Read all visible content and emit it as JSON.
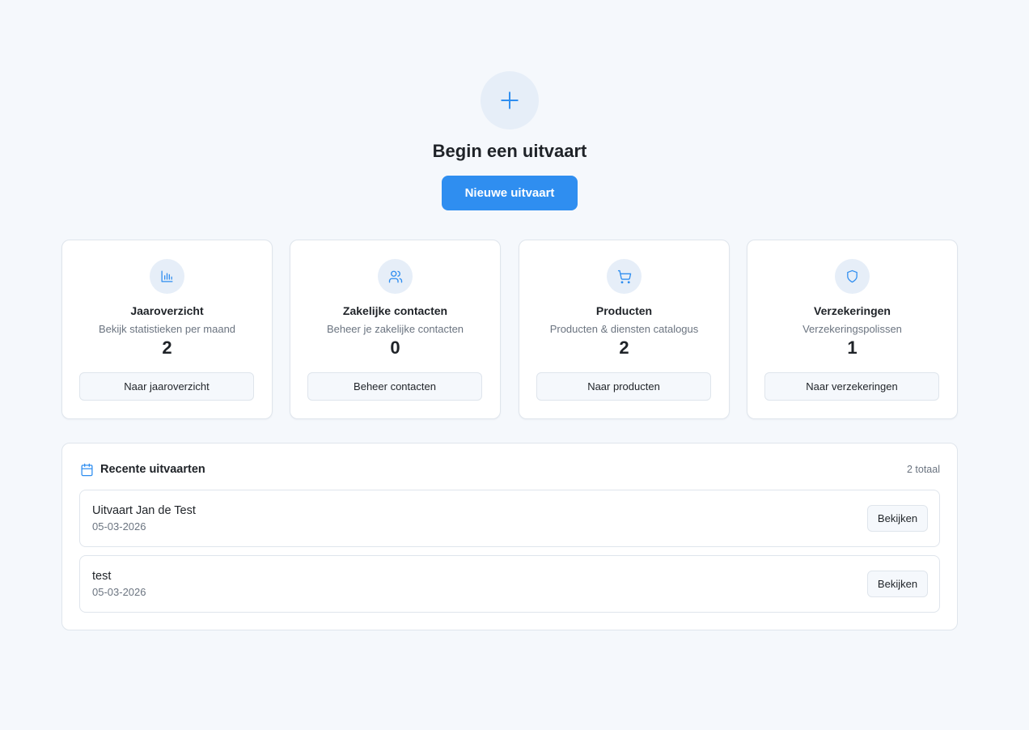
{
  "hero": {
    "icon": "plus-icon",
    "title": "Begin een uitvaart",
    "button_label": "Nieuwe uitvaart"
  },
  "colors": {
    "accent": "#2f8ef0",
    "background": "#f5f8fc",
    "icon_bg": "#e6eef8"
  },
  "cards": [
    {
      "icon": "bar-chart-icon",
      "title": "Jaaroverzicht",
      "subtitle": "Bekijk statistieken per maand",
      "count": "2",
      "button_label": "Naar jaaroverzicht"
    },
    {
      "icon": "users-icon",
      "title": "Zakelijke contacten",
      "subtitle": "Beheer je zakelijke contacten",
      "count": "0",
      "button_label": "Beheer contacten"
    },
    {
      "icon": "shopping-cart-icon",
      "title": "Producten",
      "subtitle": "Producten & diensten catalogus",
      "count": "2",
      "button_label": "Naar producten"
    },
    {
      "icon": "shield-icon",
      "title": "Verzekeringen",
      "subtitle": "Verzekeringspolissen",
      "count": "1",
      "button_label": "Naar verzekeringen"
    }
  ],
  "recent": {
    "icon": "calendar-icon",
    "title": "Recente uitvaarten",
    "total": "2 totaal",
    "items": [
      {
        "name": "Uitvaart Jan de Test",
        "date": "05-03-2026",
        "button_label": "Bekijken"
      },
      {
        "name": "test",
        "date": "05-03-2026",
        "button_label": "Bekijken"
      }
    ]
  }
}
